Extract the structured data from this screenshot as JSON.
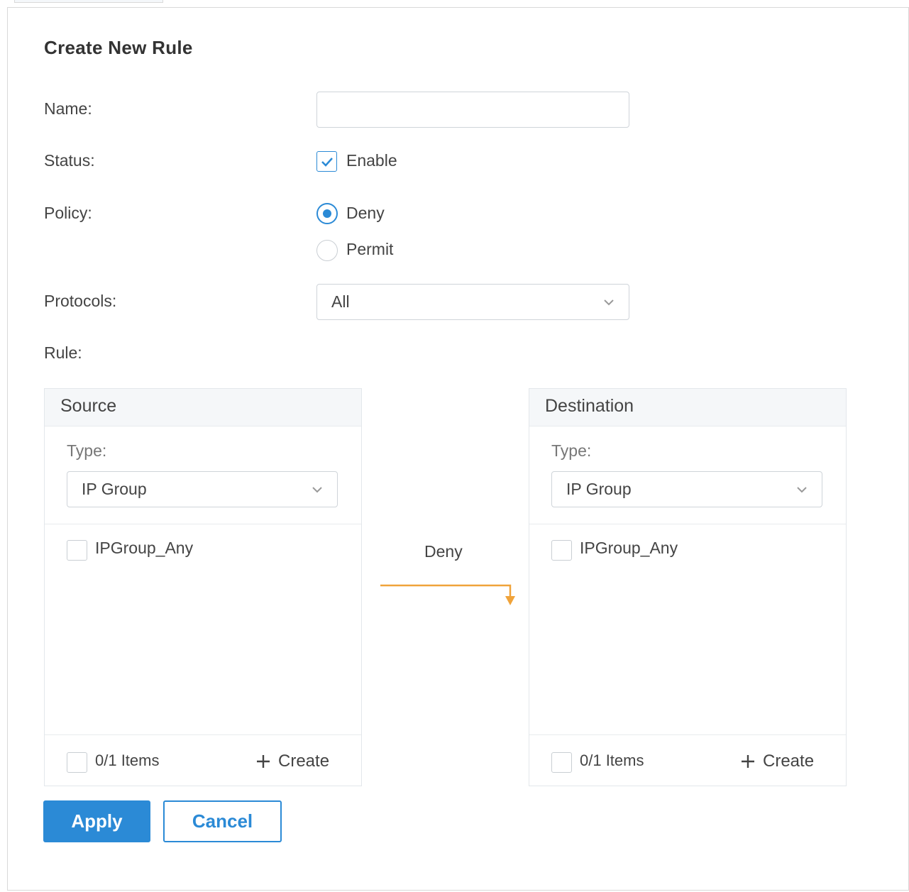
{
  "form": {
    "title": "Create New Rule",
    "name_label": "Name:",
    "name_value": "",
    "status_label": "Status:",
    "status_option": "Enable",
    "status_checked": true,
    "policy_label": "Policy:",
    "policy_options": [
      "Deny",
      "Permit"
    ],
    "policy_selected": "Deny",
    "protocols_label": "Protocols:",
    "protocols_value": "All",
    "rule_label": "Rule:"
  },
  "source": {
    "header": "Source",
    "type_label": "Type:",
    "type_value": "IP Group",
    "items": [
      "IPGroup_Any"
    ],
    "count": "0/1 Items",
    "create_label": "Create"
  },
  "arrow": {
    "label": "Deny",
    "color": "#f0a33a"
  },
  "destination": {
    "header": "Destination",
    "type_label": "Type:",
    "type_value": "IP Group",
    "items": [
      "IPGroup_Any"
    ],
    "count": "0/1 Items",
    "create_label": "Create"
  },
  "buttons": {
    "apply": "Apply",
    "cancel": "Cancel"
  },
  "colors": {
    "accent": "#2b8ad6",
    "arrow": "#f0a33a"
  }
}
